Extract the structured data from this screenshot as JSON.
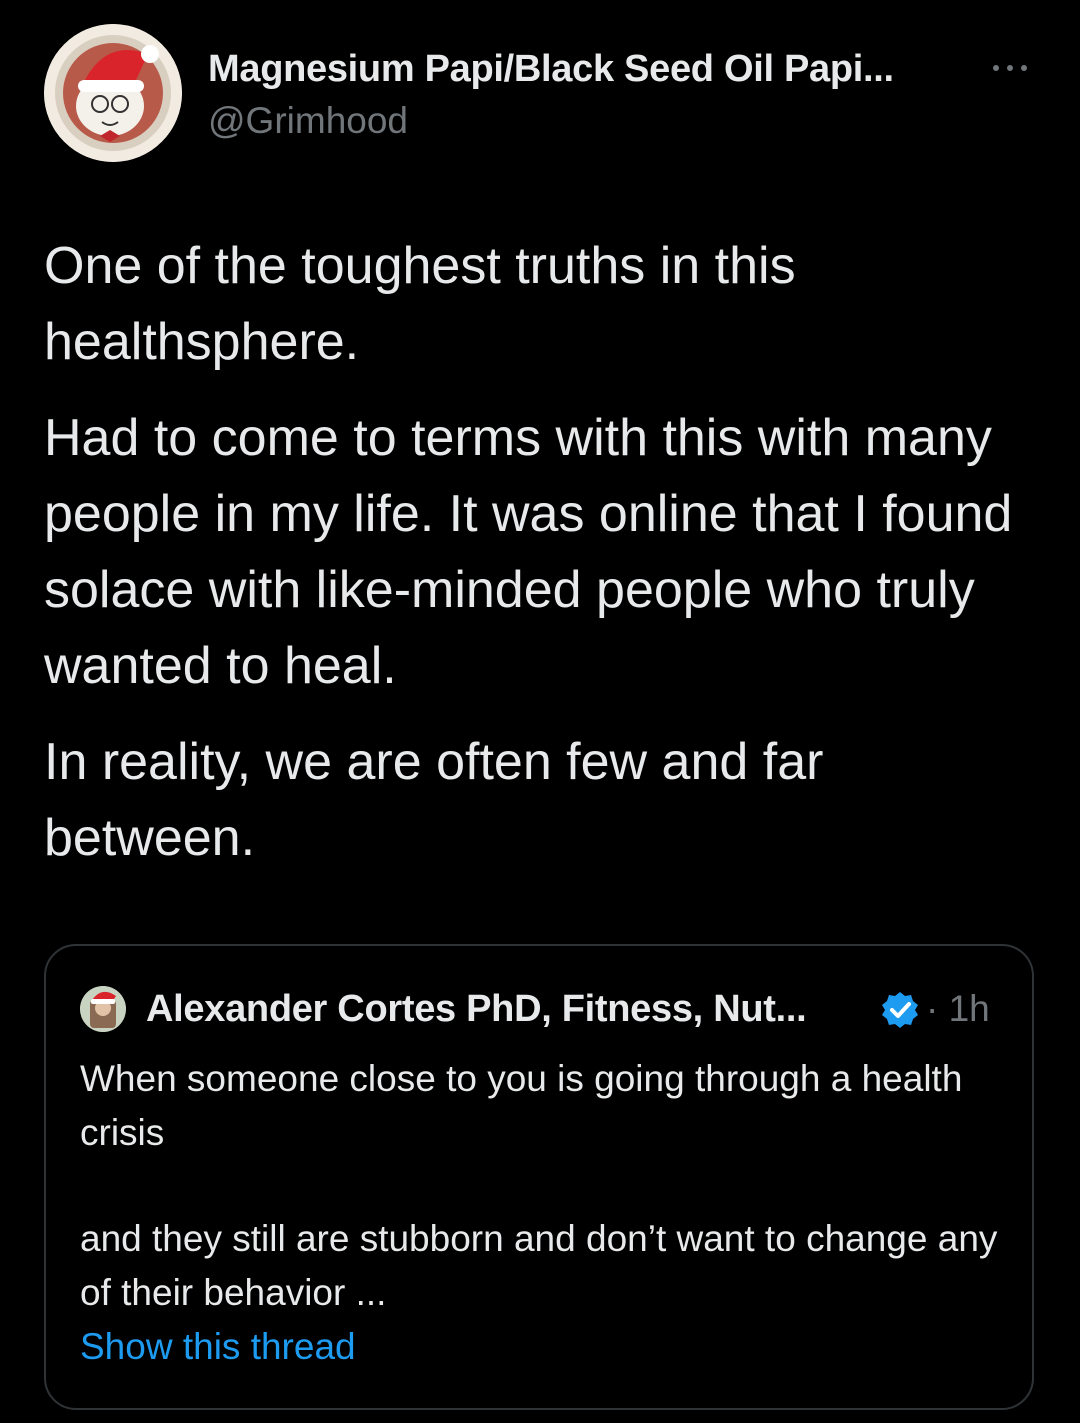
{
  "author": {
    "display_name": "Magnesium Papi/Black Seed Oil Papi...",
    "handle": "@Grimhood",
    "avatar_icon": "cartoon-santa-hat-avatar"
  },
  "more_icon": "more-dots-icon",
  "tweet": {
    "paragraphs": [
      "One of the toughest truths in this healthsphere.",
      "Had to come to terms with this with many people in my life. It was online that I found solace with like-minded people who truly wanted to heal.",
      "In reality, we are often few and far between."
    ]
  },
  "quoted_tweet": {
    "author_name": "Alexander Cortes PhD, Fitness, Nut...",
    "verified_icon": "verified-badge-icon",
    "time": "· 1h",
    "text_part1": "When someone close to you is going through a health crisis",
    "text_part2": "and they still are stubborn and don’t want to change any of their behavior ...",
    "show_thread": "Show this thread"
  },
  "colors": {
    "background": "#000000",
    "primary_text": "#e7e9ea",
    "secondary_text": "#71767b",
    "link": "#1d9bf0",
    "border": "#2f3336",
    "verified": "#1d9bf0"
  }
}
